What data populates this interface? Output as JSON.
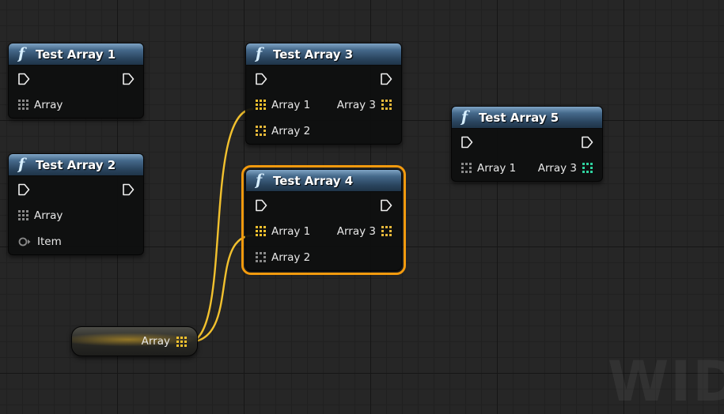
{
  "nodes": [
    {
      "title": "Test Array 1",
      "inputs": [
        {
          "label": "Array",
          "kind": "array",
          "connected": false
        }
      ],
      "outputs": []
    },
    {
      "title": "Test Array 2",
      "inputs": [
        {
          "label": "Array",
          "kind": "array",
          "connected": false
        },
        {
          "label": "Item",
          "kind": "wildcard",
          "connected": false
        }
      ],
      "outputs": []
    },
    {
      "title": "Test Array 3",
      "inputs": [
        {
          "label": "Array 1",
          "kind": "array",
          "connected": true
        },
        {
          "label": "Array 2",
          "kind": "array",
          "connected": false
        }
      ],
      "outputs": [
        {
          "label": "Array 3",
          "kind": "array"
        }
      ]
    },
    {
      "title": "Test Array 4",
      "selected": true,
      "inputs": [
        {
          "label": "Array 1",
          "kind": "array",
          "connected": true
        },
        {
          "label": "Array 2",
          "kind": "array",
          "connected": false
        }
      ],
      "outputs": [
        {
          "label": "Array 3",
          "kind": "array"
        }
      ]
    },
    {
      "title": "Test Array 5",
      "inputs": [
        {
          "label": "Array 1",
          "kind": "array",
          "connected": false
        }
      ],
      "outputs": [
        {
          "label": "Array 3",
          "kind": "array"
        }
      ]
    }
  ],
  "variable_node": {
    "label": "Array",
    "kind": "array"
  },
  "watermark": "WIDG",
  "colors": {
    "background": "#262626",
    "wire": "#f2c12e",
    "array_pin_connected": "#f2c12e",
    "array_pin_output": "#e8b93a",
    "array_pin_teal": "#2fd3a0",
    "array_pin_unconnected": "#8a8a8a",
    "header": "#3b5b7a",
    "selection": "#f29a0e"
  },
  "icons": {
    "function": "function-icon",
    "exec": "exec-pin-icon",
    "array": "array-pin-icon",
    "wildcard": "wildcard-pin-icon"
  }
}
